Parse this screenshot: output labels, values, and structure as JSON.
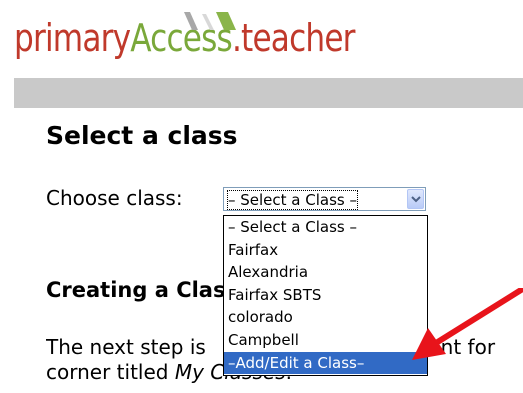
{
  "logo": {
    "part_primary": "primary",
    "part_access": "Access",
    "part_teacher": ".teacher"
  },
  "page": {
    "title": "Select a class",
    "choose_label": "Choose class:",
    "section_title": "Creating a Class",
    "instruction_line1_visible": "The next step is",
    "instruction_line1_tail": "unt for",
    "instruction_line2_prefix": "corner titled ",
    "instruction_line2_italic": "My Classes",
    "instruction_line2_suffix": "."
  },
  "class_select": {
    "selected": "– Select a Class –",
    "options": [
      "– Select a Class –",
      "Fairfax",
      "Alexandria",
      "Fairfax SBTS",
      "colorado",
      "Campbell",
      "–Add/Edit a Class–"
    ],
    "highlighted_index": 6
  },
  "colors": {
    "logo_red": "#c0392b",
    "logo_green": "#7aa83a",
    "header_bar": "#c9c9c9",
    "highlight": "#316ac5",
    "annotation_arrow": "#e8141b"
  },
  "icons": {
    "logo_mark": "pencil-logo-icon",
    "dropdown_arrow": "chevron-down-icon",
    "annotation": "red-arrow-annotation"
  }
}
